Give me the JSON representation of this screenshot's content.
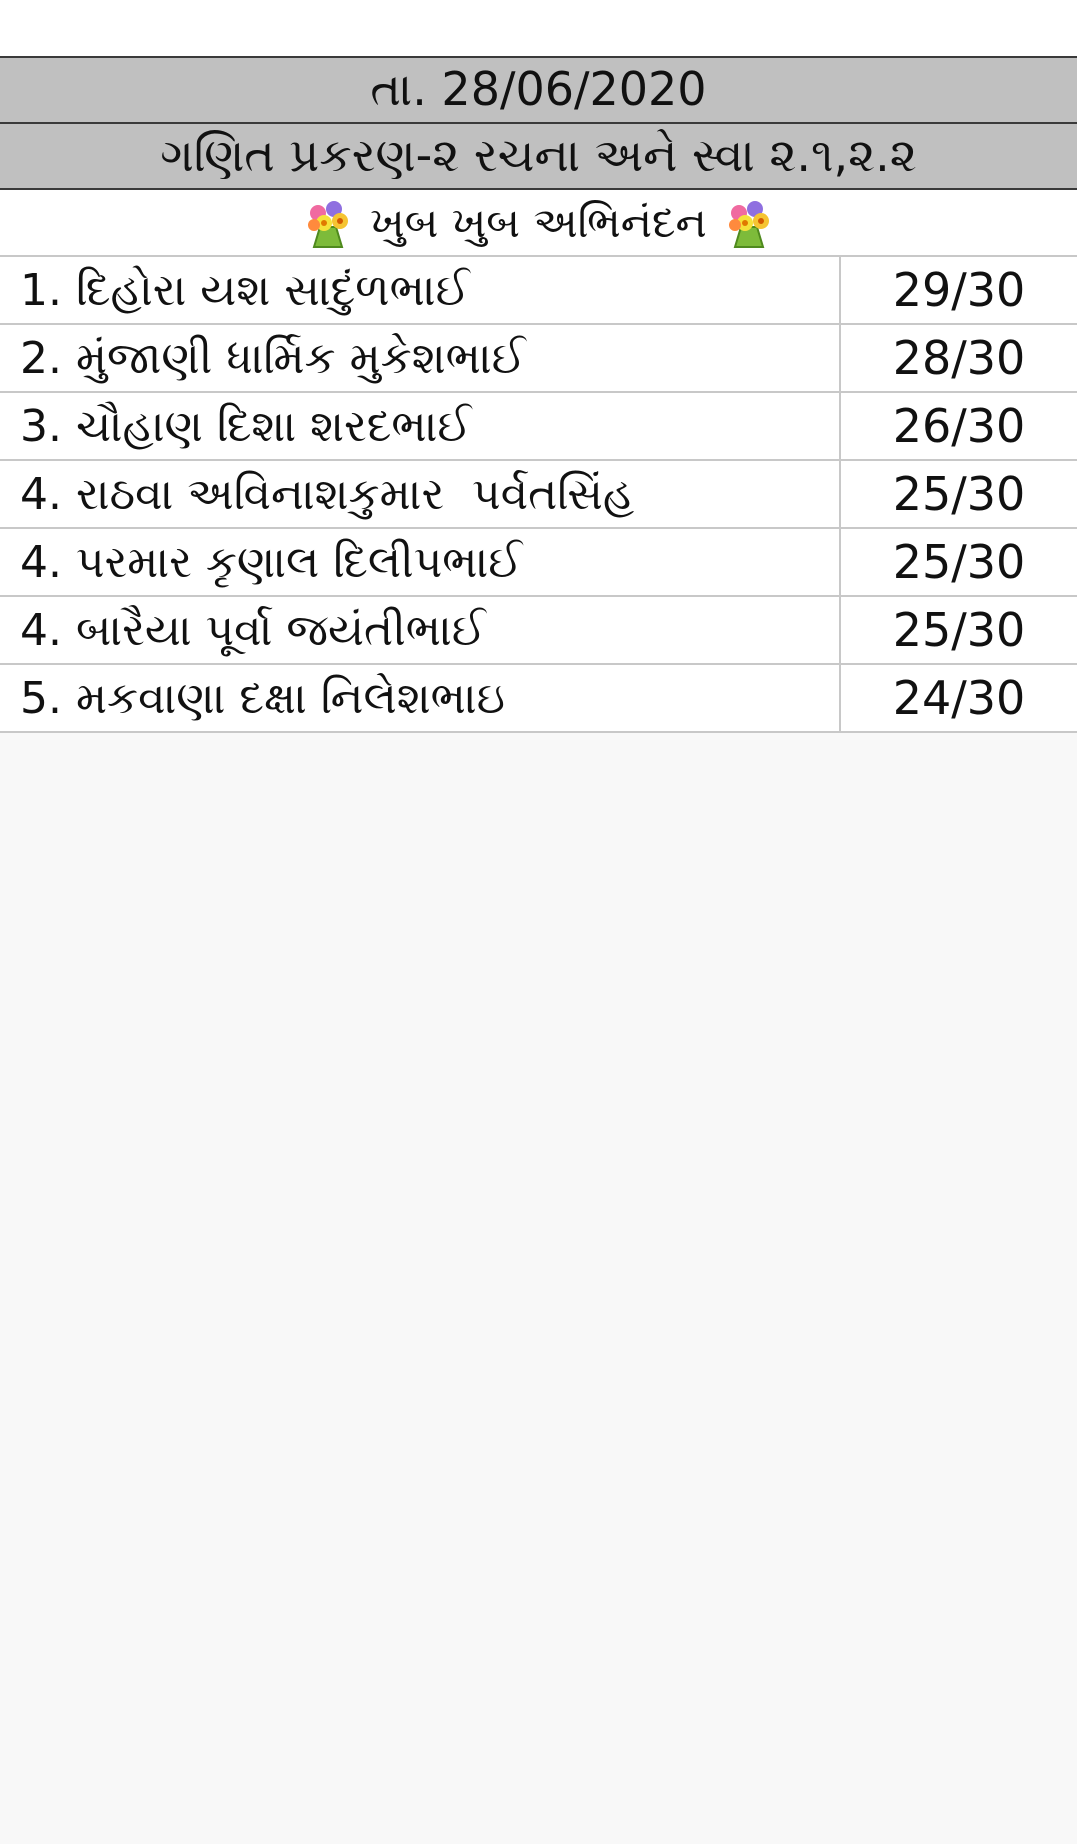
{
  "sheet": {
    "date_label": "તા. 28/06/2020",
    "topic_label": "ગણિત પ્રકરણ-૨ રચના અને સ્વા ૨.૧,૨.૨",
    "congrats_label": "ખુબ ખુબ અભિનંદન",
    "congrats_icon": "bouquet-icon",
    "rows": [
      {
        "name": "1. દિહોરા યશ સાદુંળભાઈ",
        "score": "29/30"
      },
      {
        "name": "2. મુંજાણી ધાર્મિક મુકેશભાઈ",
        "score": "28/30"
      },
      {
        "name": "3. ચૌહાણ દિશા શરદભાઈ",
        "score": "26/30"
      },
      {
        "name": "4. રાઠવા અવિનાશકુમાર  પર્વતસિંહ",
        "score": "25/30"
      },
      {
        "name": "4. પરમાર કૃણાલ દિલીપભાઈ",
        "score": "25/30"
      },
      {
        "name": "4. બારૈયા પૂર્વા જયંતીભાઈ",
        "score": "25/30"
      },
      {
        "name": "5. મકવાણા દક્ષા નિલેશભાઇ",
        "score": "24/30"
      }
    ]
  }
}
